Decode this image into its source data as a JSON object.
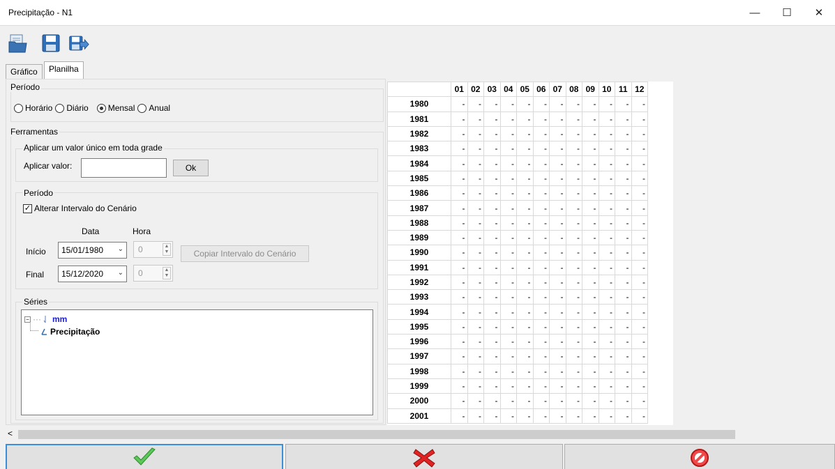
{
  "window": {
    "title": "Precipitação - N1",
    "minimize": "—",
    "maximize": "☐",
    "close": "✕"
  },
  "tabs": [
    {
      "label": "Gráfico"
    },
    {
      "label": "Planilha"
    }
  ],
  "periodo_top": {
    "label": "Período",
    "options": [
      {
        "label": "Horário",
        "selected": false
      },
      {
        "label": "Diário",
        "selected": false
      },
      {
        "label": "Mensal",
        "selected": true
      },
      {
        "label": "Anual",
        "selected": false
      }
    ]
  },
  "ferramentas": {
    "label": "Ferramentas",
    "aplicar_group_label": "Aplicar um valor único em toda grade",
    "aplicar_label": "Aplicar valor:",
    "aplicar_value": "",
    "ok_label": "Ok",
    "periodo_label": "Período",
    "alterar_label": "Alterar Intervalo do Cenário",
    "alterar_checked": true,
    "data_header": "Data",
    "hora_header": "Hora",
    "inicio_label": "Início",
    "inicio_data": "15/01/1980",
    "inicio_hora": "0",
    "final_label": "Final",
    "final_data": "15/12/2020",
    "final_hora": "0",
    "copiar_label": "Copiar Intervalo do Cenário"
  },
  "series": {
    "label": "Séries",
    "root": "mm",
    "child": "Precipitação"
  },
  "grid": {
    "columns": [
      "01",
      "02",
      "03",
      "04",
      "05",
      "06",
      "07",
      "08",
      "09",
      "10",
      "11",
      "12"
    ],
    "rows": [
      "1980",
      "1981",
      "1982",
      "1983",
      "1984",
      "1985",
      "1986",
      "1987",
      "1988",
      "1989",
      "1990",
      "1991",
      "1992",
      "1993",
      "1994",
      "1995",
      "1996",
      "1997",
      "1998",
      "1999",
      "2000",
      "2001"
    ],
    "cell_value": "-"
  },
  "colors": {
    "ok": "#3cb043",
    "cancel": "#d32020",
    "abort": "#e02828"
  }
}
